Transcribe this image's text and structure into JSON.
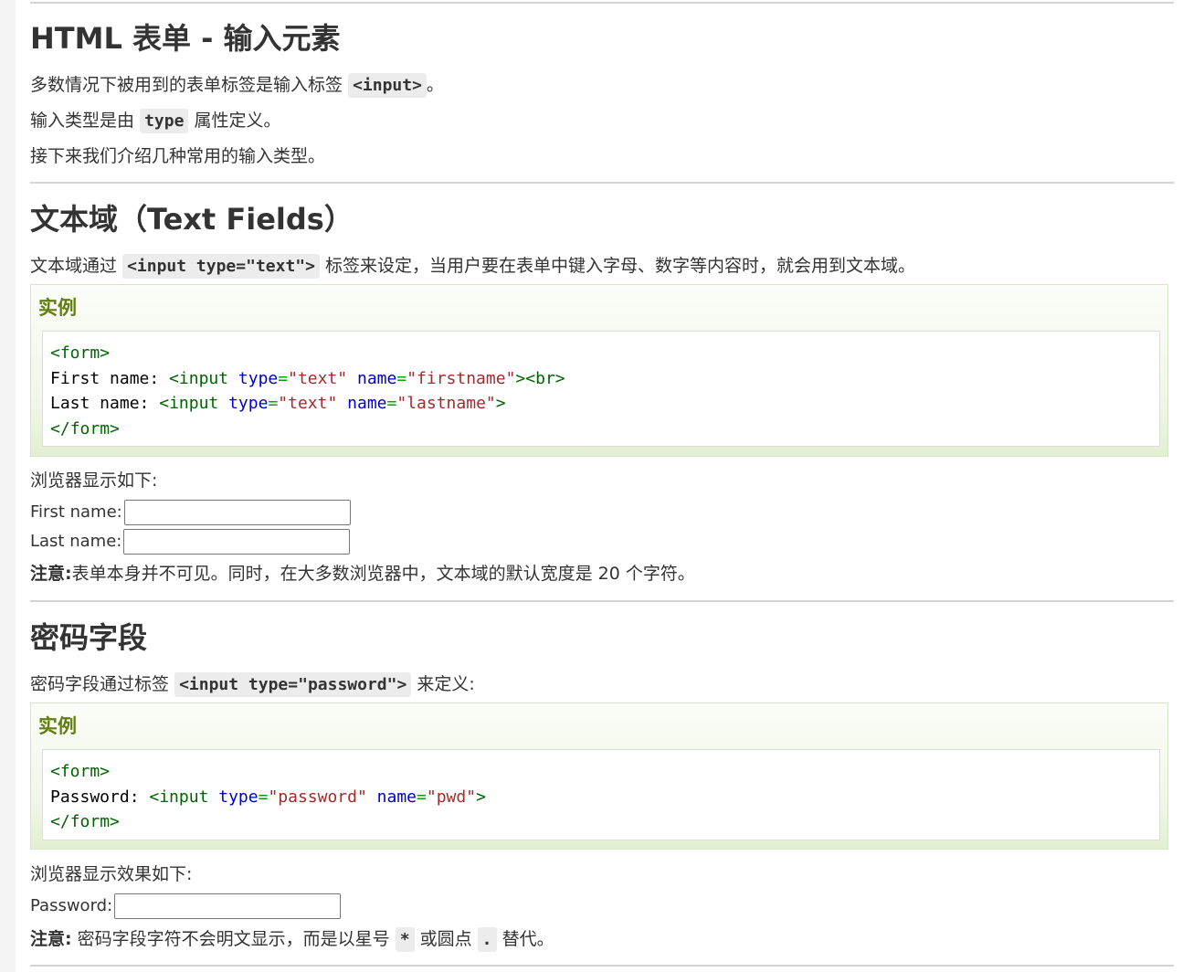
{
  "section1": {
    "title": "HTML 表单 - 输入元素",
    "p1_before": "多数情况下被用到的表单标签是输入标签",
    "p1_code": "<input>",
    "p1_after": "。",
    "p2_before": "输入类型是由",
    "p2_code": "type",
    "p2_after": "属性定义。",
    "p3": "接下来我们介绍几种常用的输入类型。"
  },
  "section2": {
    "title": "文本域（Text Fields）",
    "p1_before": "文本域通过",
    "p1_code": "<input type=\"text\">",
    "p1_after": "标签来设定，当用户要在表单中键入字母、数字等内容时，就会用到文本域。",
    "example_title": "实例",
    "code": {
      "l1_tag": "form",
      "l2_text": "First name: ",
      "l2_tag": "input",
      "attr_type": "type",
      "val_text": "\"text\"",
      "attr_name": "name",
      "val_firstname": "\"firstname\"",
      "br_tag": "br",
      "l3_text": "Last name: ",
      "val_lastname": "\"lastname\""
    },
    "display_label": "浏览器显示如下:",
    "first_label": "First name:",
    "last_label": "Last name:",
    "note_bold": "注意:",
    "note_text": "表单本身并不可见。同时，在大多数浏览器中，文本域的默认宽度是 20 个字符。"
  },
  "section3": {
    "title": "密码字段",
    "p1_before": "密码字段通过标签",
    "p1_code": "<input type=\"password\">",
    "p1_after": "来定义:",
    "example_title": "实例",
    "code": {
      "l2_text": "Password: ",
      "val_password": "\"password\"",
      "val_pwd": "\"pwd\""
    },
    "display_label": "浏览器显示效果如下:",
    "password_label": "Password:",
    "note_bold": "注意:",
    "note_text1": "密码字段字符不会明文显示，而是以星号",
    "note_code1": "*",
    "note_text2": "或圆点",
    "note_code2": ".",
    "note_text3": "替代。"
  }
}
